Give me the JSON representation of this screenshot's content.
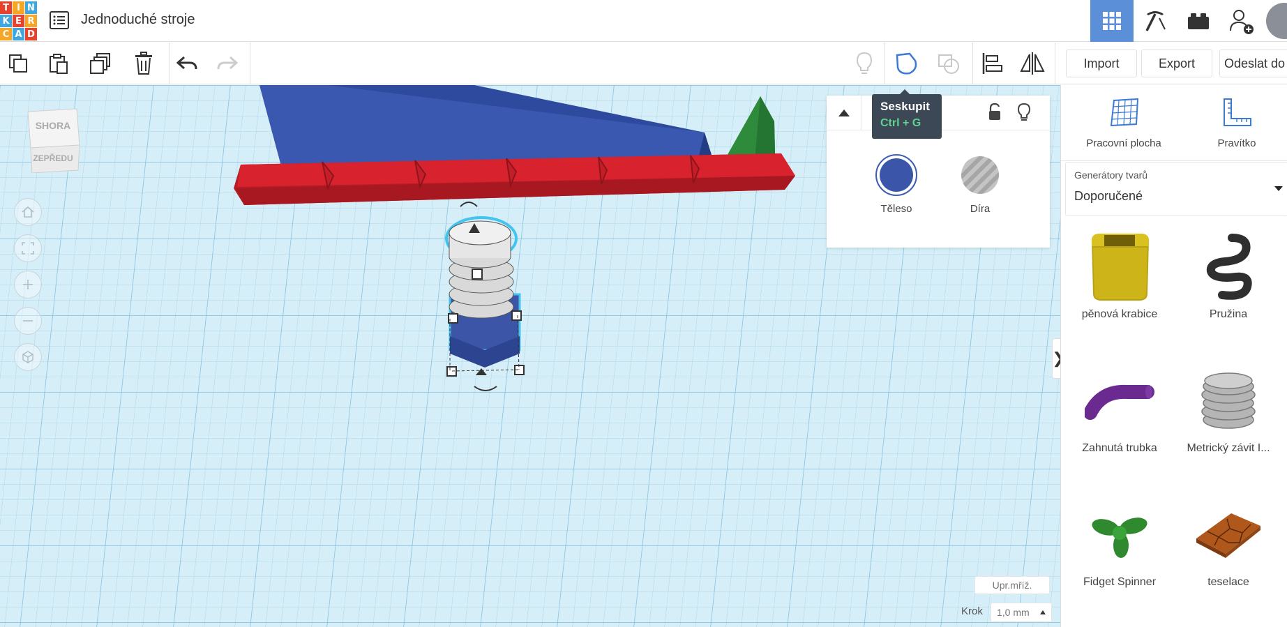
{
  "logo": {
    "letters": [
      "T",
      "I",
      "N",
      "K",
      "E",
      "R",
      "C",
      "A",
      "D"
    ],
    "colors": [
      "#e8412d",
      "#f6a623",
      "#3ea7e0",
      "#3ea7e0",
      "#e8412d",
      "#f6a623",
      "#f6a623",
      "#3ea7e0",
      "#e8412d"
    ]
  },
  "header": {
    "title": "Jednoduché stroje"
  },
  "toolbar": {
    "import_label": "Import",
    "export_label": "Export",
    "send_label": "Odeslat do"
  },
  "viewcube": {
    "top_label": "SHORA",
    "front_label": "ZEPŘEDU"
  },
  "inspector": {
    "solid_label": "Těleso",
    "hole_label": "Díra",
    "solid_color": "#3b56a8"
  },
  "tooltip": {
    "title": "Seskupit",
    "shortcut": "Ctrl + G"
  },
  "collapse": {
    "glyph": "❯"
  },
  "canvas_settings": {
    "grid_button": "Upr.mříž.",
    "step_label": "Krok",
    "step_value": "1,0 mm"
  },
  "right_panel": {
    "workplane_label": "Pracovní plocha",
    "ruler_label": "Pravítko",
    "generators_label": "Generátory tvarů",
    "generators_value": "Doporučené",
    "shapes": [
      "pěnová krabice",
      "Pružina",
      "Zahnutá trubka",
      "Metrický závit I...",
      "Fidget Spinner",
      "teselace"
    ]
  }
}
